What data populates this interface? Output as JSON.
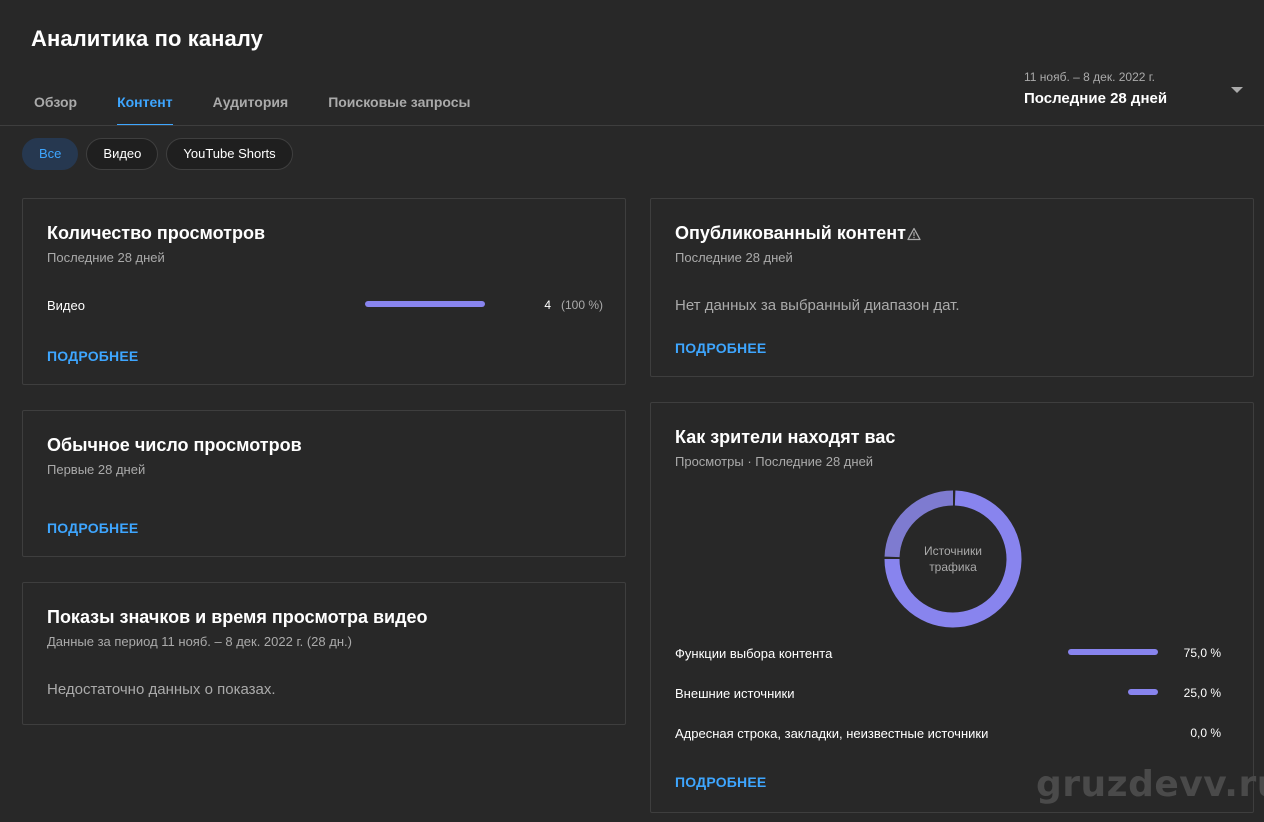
{
  "page": {
    "title": "Аналитика по каналу"
  },
  "tabs": [
    {
      "label": "Обзор",
      "active": false
    },
    {
      "label": "Контент",
      "active": true
    },
    {
      "label": "Аудитория",
      "active": false
    },
    {
      "label": "Поисковые запросы",
      "active": false
    }
  ],
  "date_picker": {
    "range": "11 нояб. – 8 дек. 2022 г.",
    "label": "Последние 28 дней"
  },
  "chips": [
    {
      "label": "Все",
      "active": true
    },
    {
      "label": "Видео",
      "active": false
    },
    {
      "label": "YouTube Shorts",
      "active": false
    }
  ],
  "views_card": {
    "title": "Количество просмотров",
    "subtitle": "Последние 28 дней",
    "row_label": "Видео",
    "row_value": "4",
    "row_percent": "(100 %)",
    "row_fraction": 1.0,
    "more": "ПОДРОБНЕЕ"
  },
  "typical_views_card": {
    "title": "Обычное число просмотров",
    "subtitle": "Первые 28 дней",
    "more": "ПОДРОБНЕЕ"
  },
  "impressions_card": {
    "title": "Показы значков и время просмотра видео",
    "subtitle": "Данные за период 11 нояб. – 8 дек. 2022 г. (28 дн.)",
    "empty": "Недостаточно данных о показах."
  },
  "published_card": {
    "title": "Опубликованный контент",
    "subtitle": "Последние 28 дней",
    "empty": "Нет данных за выбранный диапазон дат.",
    "more": "ПОДРОБНЕЕ"
  },
  "traffic_card": {
    "title": "Как зрители находят вас",
    "subtitle": "Просмотры · Последние 28 дней",
    "donut_line1": "Источники",
    "donut_line2": "трафика",
    "sources": [
      {
        "label": "Функции выбора контента",
        "value": "75,0 %",
        "fraction": 0.75
      },
      {
        "label": "Внешние источники",
        "value": "25,0 %",
        "fraction": 0.25
      },
      {
        "label": "Адресная строка, закладки, неизвестные источники",
        "value": "0,0 %",
        "fraction": 0.0
      }
    ],
    "more": "ПОДРОБНЕЕ"
  },
  "colors": {
    "accent": "#3ea6ff",
    "bar": "#8884ee",
    "donut_secondary": "#7e7bd0",
    "background": "#282828"
  },
  "watermark": "gruzdevv.ru"
}
